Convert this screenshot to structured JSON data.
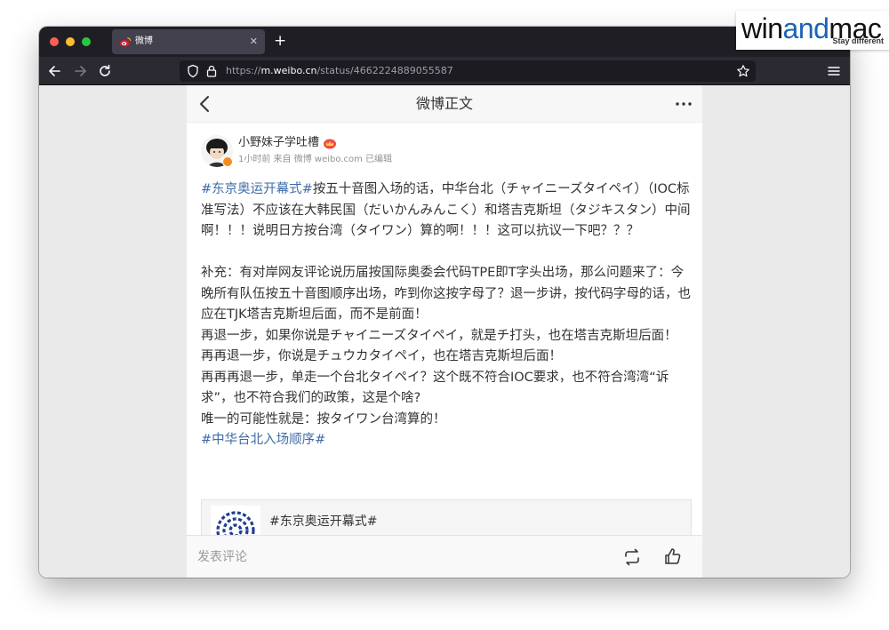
{
  "watermark": {
    "brand_prefix": "win",
    "brand_mid": "and",
    "brand_suffix": "mac",
    "tagline": "Stay different"
  },
  "browser": {
    "tab_title": "微博",
    "tab_close": "✕",
    "new_tab": "+",
    "url_scheme": "https://",
    "url_host": "m.weibo.cn",
    "url_path": "/status/4662224889055587"
  },
  "header": {
    "title": "微博正文"
  },
  "post": {
    "username": "小野妹子学吐槽",
    "meta": "1小时前 来自 微博 weibo.com 已编辑",
    "hashtag_open": "#东京奥运开幕式#",
    "para1_rest": "按五十音图入场的话，中华台北（チャイニーズタイペイ）（IOC标准写法）不应该在大韩民国（だいかんみんこく）和塔吉克斯坦（タジキスタン）中间啊！！！说明日方按台湾（タイワン）算的啊！！！这可以抗议一下吧？？？",
    "para2": "补充：有对岸网友评论说历届按国际奥委会代码TPE即T字头出场，那么问题来了：今晚所有队伍按五十音图顺序出场，咋到你这按字母了？退一步讲，按代码字母的话，也应在TJK塔吉克斯坦后面，而不是前面！",
    "para3": "再退一步，如果你说是チャイニーズタイペイ，就是チ打头，也在塔吉克斯坦后面！",
    "para4": "再再退一步，你说是チュウカタイペイ，也在塔吉克斯坦后面！",
    "para5": "再再再退一步，单走一个台北タイペイ？这个既不符合IOC要求，也不符合湾湾“诉求”，也不符合我们的政策，这是个啥?",
    "para6": "唯一的可能性就是：按タイワン台湾算的！",
    "hashtag_close": "#中华台北入场顺序#"
  },
  "card": {
    "title": "#东京奥运开幕式#"
  },
  "footer": {
    "comment_placeholder": "发表评论"
  },
  "colors": {
    "link": "#3f6ca8",
    "accent": "#f78b1e"
  }
}
